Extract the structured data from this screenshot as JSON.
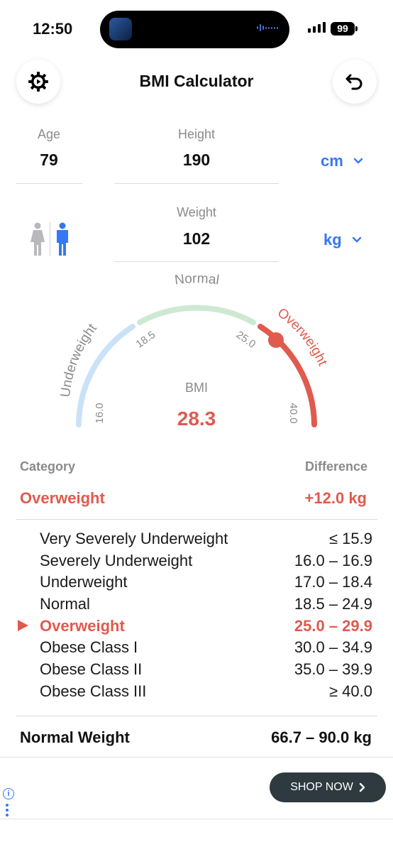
{
  "status": {
    "time": "12:50",
    "battery": "99"
  },
  "header": {
    "title": "BMI Calculator",
    "settings_icon": "gear-icon",
    "back_icon": "undo-icon"
  },
  "fields": {
    "age": {
      "label": "Age",
      "value": "79"
    },
    "height": {
      "label": "Height",
      "value": "190",
      "unit": "cm"
    },
    "weight": {
      "label": "Weight",
      "value": "102",
      "unit": "kg"
    },
    "sex": {
      "female_icon": "female-icon",
      "male_icon": "male-icon",
      "selected": "male"
    }
  },
  "gauge": {
    "labels": {
      "underweight": "Underweight",
      "normal": "Normal",
      "overweight": "Overweight"
    },
    "ticks": [
      "16.0",
      "18.5",
      "25.0",
      "40.0"
    ],
    "bmi_label": "BMI",
    "bmi_value": "28.3",
    "colors": {
      "underweight": "#c9e2f7",
      "normal": "#cde9d3",
      "overweight": "#e05a4e"
    }
  },
  "category": {
    "head_label": "Category",
    "diff_label": "Difference",
    "value": "Overweight",
    "difference": "+12.0 kg"
  },
  "ranges": [
    {
      "name": "Very Severely Underweight",
      "range": "≤ 15.9",
      "active": false
    },
    {
      "name": "Severely Underweight",
      "range": "16.0 – 16.9",
      "active": false
    },
    {
      "name": "Underweight",
      "range": "17.0 – 18.4",
      "active": false
    },
    {
      "name": "Normal",
      "range": "18.5 – 24.9",
      "active": false
    },
    {
      "name": "Overweight",
      "range": "25.0 – 29.9",
      "active": true
    },
    {
      "name": "Obese Class I",
      "range": "30.0 – 34.9",
      "active": false
    },
    {
      "name": "Obese Class II",
      "range": "35.0 – 39.9",
      "active": false
    },
    {
      "name": "Obese Class III",
      "range": "≥ 40.0",
      "active": false
    }
  ],
  "normal_weight": {
    "label": "Normal Weight",
    "value": "66.7 – 90.0 kg"
  },
  "ad": {
    "button": "SHOP NOW"
  },
  "colors": {
    "accent": "#3478f6",
    "alert": "#e05a4e"
  }
}
